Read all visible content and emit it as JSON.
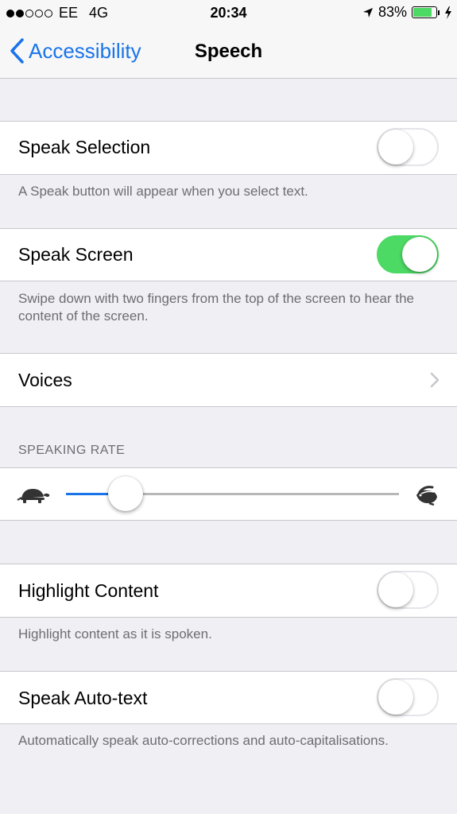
{
  "status_bar": {
    "carrier": "EE",
    "network": "4G",
    "time": "20:34",
    "battery_percent_text": "83%",
    "battery_level": 0.83,
    "signal_bars_filled": 2,
    "signal_bars_total": 5
  },
  "nav": {
    "back_label": "Accessibility",
    "title": "Speech"
  },
  "rows": {
    "speak_selection": {
      "label": "Speak Selection",
      "on": false,
      "footer": "A Speak button will appear when you select text."
    },
    "speak_screen": {
      "label": "Speak Screen",
      "on": true,
      "footer": "Swipe down with two fingers from the top of the screen to hear the content of the screen."
    },
    "voices": {
      "label": "Voices"
    },
    "speaking_rate": {
      "header": "SPEAKING RATE",
      "value": 0.18,
      "slow_icon": "tortoise-icon",
      "fast_icon": "hare-icon"
    },
    "highlight_content": {
      "label": "Highlight Content",
      "on": false,
      "footer": "Highlight content as it is spoken."
    },
    "speak_auto_text": {
      "label": "Speak Auto-text",
      "on": false,
      "footer": "Automatically speak auto-corrections and auto-capitalisations."
    }
  },
  "colors": {
    "accent": "#1a74e8",
    "switch_on": "#4cd964",
    "background": "#efeff4"
  }
}
